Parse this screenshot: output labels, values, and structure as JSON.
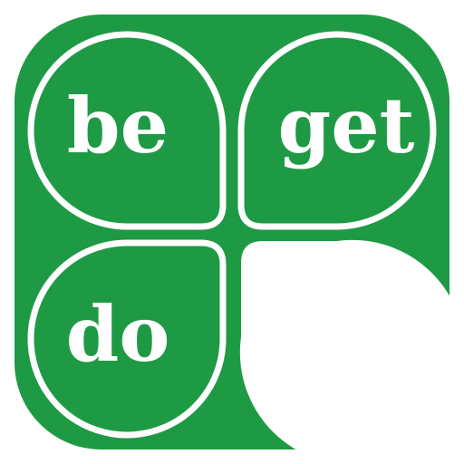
{
  "icon": {
    "colors": {
      "background": "#1e9a45",
      "foreground": "#ffffff"
    },
    "tiles": [
      {
        "word": "be"
      },
      {
        "word": "get"
      },
      {
        "word": "do"
      },
      {
        "word": ""
      }
    ]
  }
}
